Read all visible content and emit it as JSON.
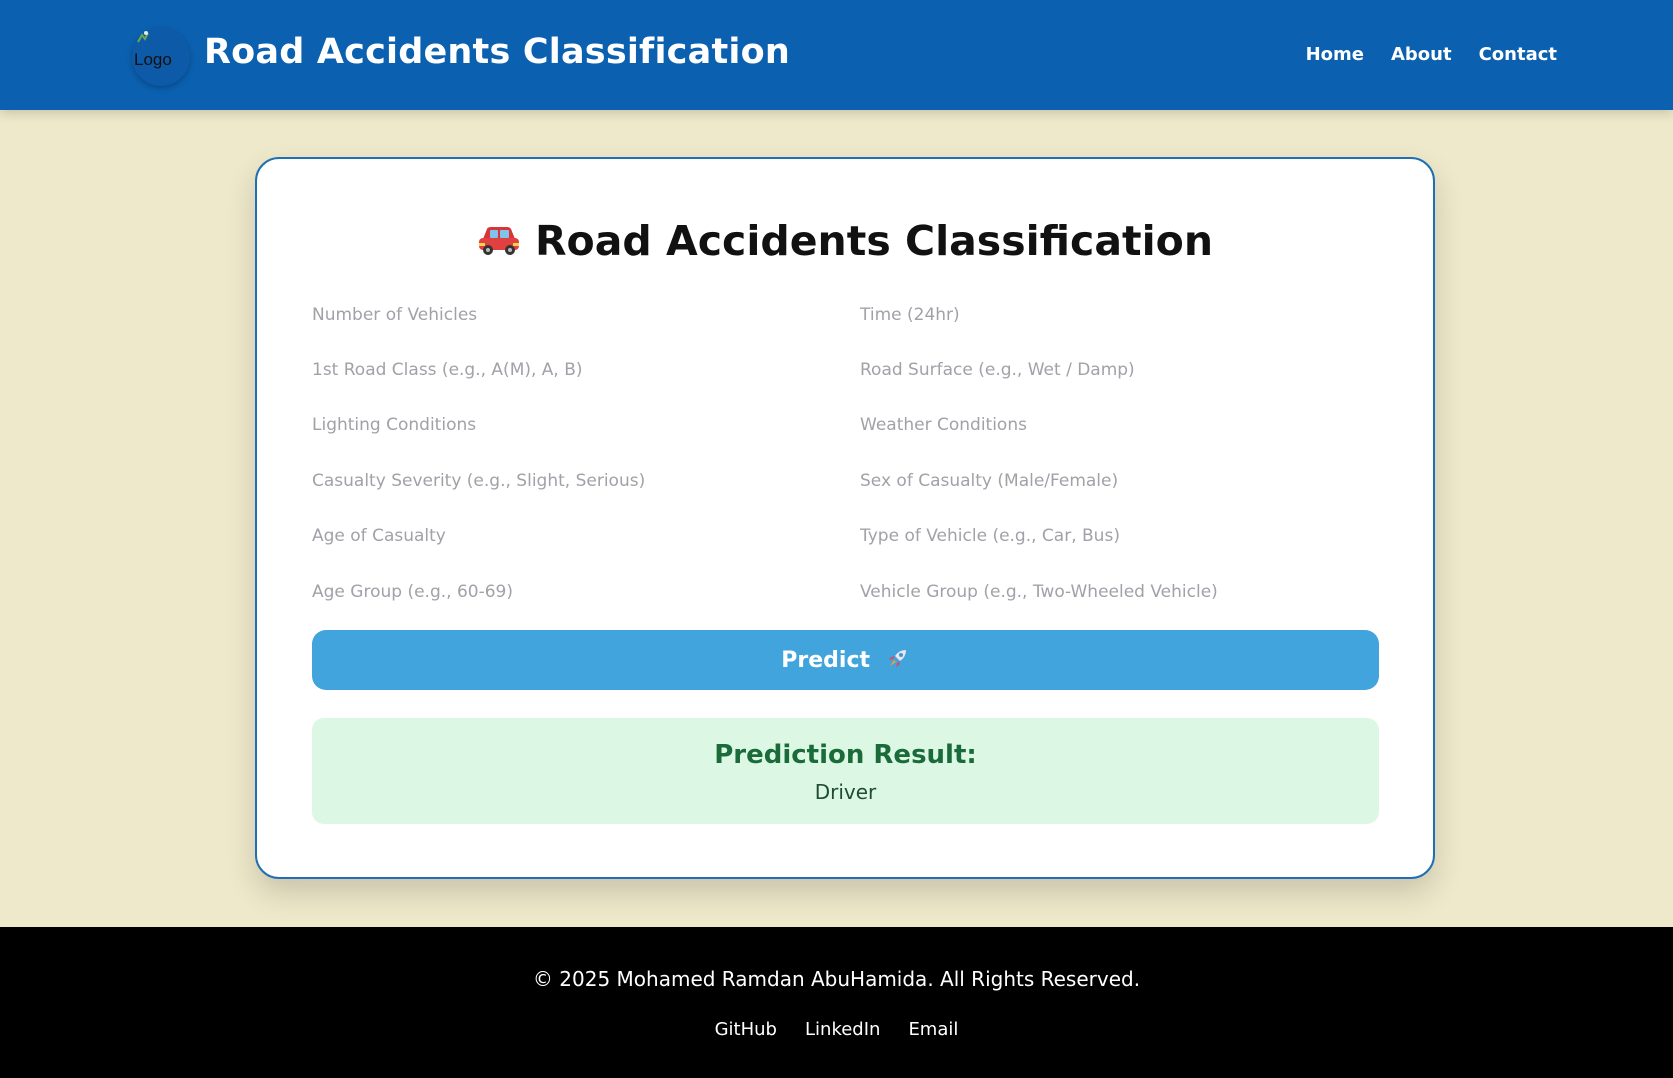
{
  "header": {
    "logo_alt": "Logo",
    "title": "Road Accidents Classification",
    "nav": [
      "Home",
      "About",
      "Contact"
    ]
  },
  "card": {
    "title": "Road Accidents Classification",
    "title_icon": "car-icon",
    "fields": [
      {
        "placeholder": "Number of Vehicles",
        "value": ""
      },
      {
        "placeholder": "Time (24hr)",
        "value": ""
      },
      {
        "placeholder": "1st Road Class (e.g., A(M), A, B)",
        "value": ""
      },
      {
        "placeholder": "Road Surface (e.g., Wet / Damp)",
        "value": ""
      },
      {
        "placeholder": "Lighting Conditions",
        "value": ""
      },
      {
        "placeholder": "Weather Conditions",
        "value": ""
      },
      {
        "placeholder": "Casualty Severity (e.g., Slight, Serious)",
        "value": ""
      },
      {
        "placeholder": "Sex of Casualty (Male/Female)",
        "value": ""
      },
      {
        "placeholder": "Age of Casualty",
        "value": ""
      },
      {
        "placeholder": "Type of Vehicle (e.g., Car, Bus)",
        "value": ""
      },
      {
        "placeholder": "Age Group (e.g., 60-69)",
        "value": ""
      },
      {
        "placeholder": "Vehicle Group (e.g., Two-Wheeled Vehicle)",
        "value": ""
      }
    ],
    "predict_label": "Predict",
    "predict_icon": "rocket-icon",
    "result_title": "Prediction Result:",
    "result_value": "Driver"
  },
  "footer": {
    "copyright": "© 2025 Mohamed Ramdan AbuHamida. All Rights Reserved.",
    "links": [
      "GitHub",
      "LinkedIn",
      "Email"
    ]
  },
  "colors": {
    "header_bg": "#0b60b0",
    "page_bg": "#efe9cb",
    "button_bg": "#42a4dc",
    "result_bg": "#dcf8e5",
    "result_text": "#1b6b3a",
    "footer_bg": "#000000"
  }
}
